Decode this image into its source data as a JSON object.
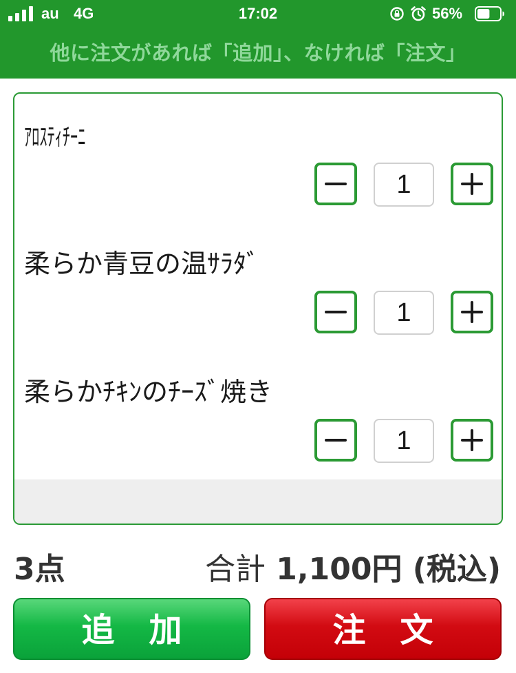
{
  "status_bar": {
    "carrier": "au",
    "network": "4G",
    "time": "17:02",
    "battery_percent": "56%",
    "battery_level": 0.56,
    "signal_bars": 4
  },
  "header": {
    "instruction": "他に注文があれば「追加」、なければ「注文」"
  },
  "items": [
    {
      "name": "ｱﾛｽﾃｨﾁｰﾆ",
      "quantity": "1"
    },
    {
      "name": "柔らか青豆の温ｻﾗﾀﾞ",
      "quantity": "1"
    },
    {
      "name": "柔らかﾁｷﾝのﾁｰｽﾞ焼き",
      "quantity": "1"
    }
  ],
  "summary": {
    "count": "3点",
    "total_label": "合計",
    "total_value": "1,100円 (税込)"
  },
  "buttons": {
    "add": "追加",
    "order": "注文"
  },
  "colors": {
    "header_bg": "#22972c",
    "accent_green": "#2b9a34",
    "add_button": "#14b845",
    "order_button": "#d20b12"
  },
  "icons": {
    "minus": "minus-icon",
    "plus": "plus-icon",
    "rotation_lock": "rotation-lock-icon",
    "alarm": "alarm-icon",
    "battery": "battery-icon",
    "signal": "signal-icon"
  }
}
